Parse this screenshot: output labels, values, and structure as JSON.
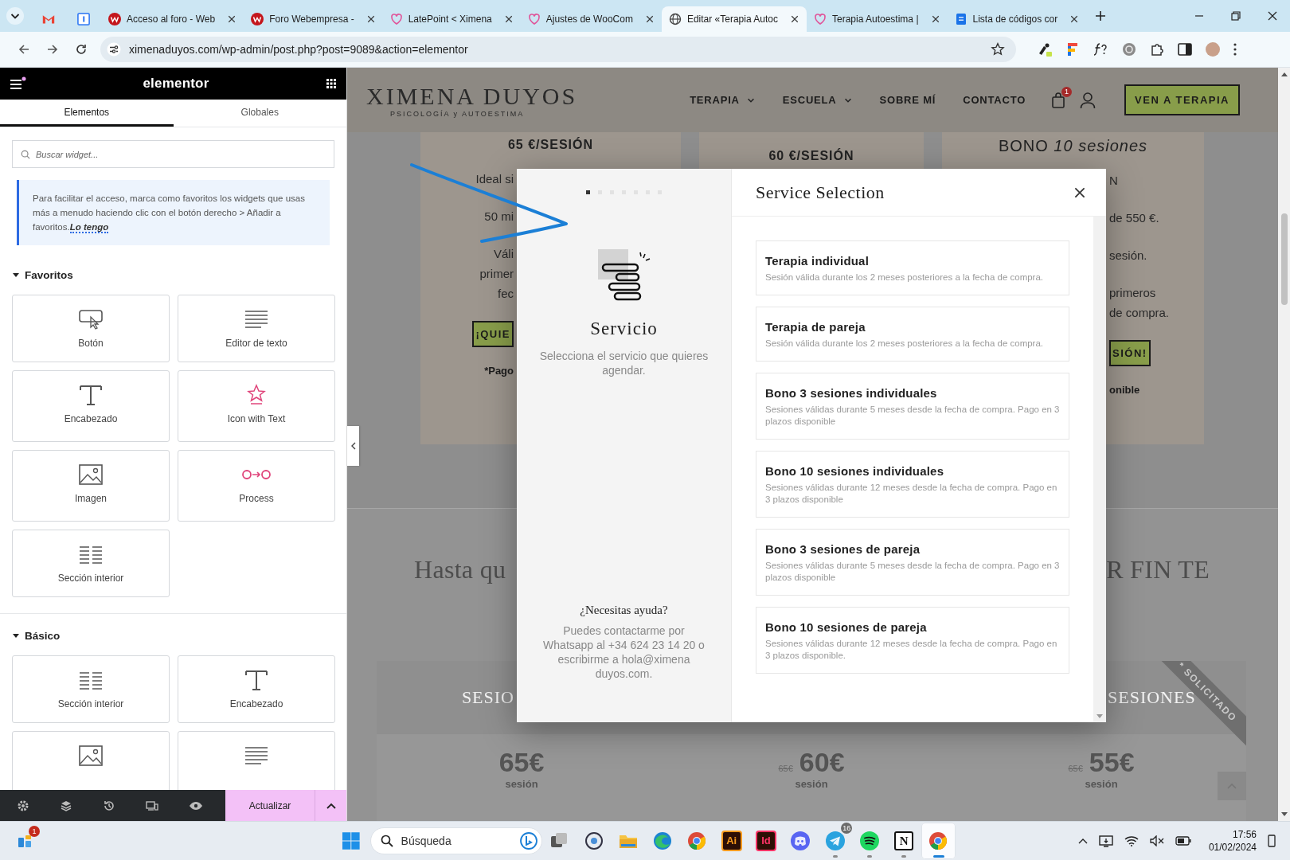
{
  "browser": {
    "tabs": [
      {
        "kind": "gmail",
        "selected": false
      },
      {
        "kind": "calendar",
        "selected": false
      },
      {
        "kind": "webempresa",
        "title": "Acceso al foro - Web",
        "selected": false
      },
      {
        "kind": "webempresa",
        "title": "Foro Webempresa -",
        "selected": false
      },
      {
        "kind": "heart",
        "title": "LatePoint < Ximena",
        "selected": false
      },
      {
        "kind": "heart",
        "title": "Ajustes de WooCom",
        "selected": false
      },
      {
        "kind": "globe",
        "title": "Editar «Terapia Autoc",
        "selected": true
      },
      {
        "kind": "heart",
        "title": "Terapia Autoestima |",
        "selected": false
      },
      {
        "kind": "docs",
        "title": "Lista de códigos cor",
        "selected": false
      }
    ],
    "url": "ximenaduyos.com/wp-admin/post.php?post=9089&action=elementor"
  },
  "editor": {
    "logo": "elementor",
    "tabs": [
      {
        "label": "Elementos",
        "selected": true
      },
      {
        "label": "Globales",
        "selected": false
      }
    ],
    "search": {
      "placeholder": "Buscar widget..."
    },
    "notice": {
      "text": "Para facilitar el acceso, marca como favoritos los widgets que usas más a menudo haciendo clic con el botón derecho > Añadir a favoritos.",
      "link": "Lo tengo"
    },
    "categories": [
      {
        "title": "Favoritos",
        "expanded": true,
        "widgets": [
          {
            "kind": "button",
            "label": "Botón"
          },
          {
            "kind": "text-editor",
            "label": "Editor de texto"
          },
          {
            "kind": "heading",
            "label": "Encabezado"
          },
          {
            "kind": "icon-text",
            "label": "Icon with Text"
          },
          {
            "kind": "image",
            "label": "Imagen"
          },
          {
            "kind": "process",
            "label": "Process"
          },
          {
            "kind": "inner-section",
            "label": "Sección interior"
          }
        ]
      },
      {
        "title": "Básico",
        "expanded": true,
        "widgets": [
          {
            "kind": "inner-section",
            "label": "Sección interior"
          },
          {
            "kind": "heading",
            "label": "Encabezado"
          },
          {
            "kind": "image"
          },
          {
            "kind": "text-editor"
          }
        ]
      }
    ],
    "update_button": "Actualizar"
  },
  "site": {
    "logo": {
      "name": "XIMENA DUYOS",
      "tagline": "PSICOLOGÍA y AUTOESTIMA"
    },
    "nav": [
      {
        "label": "TERAPIA",
        "dropdown": true
      },
      {
        "label": "ESCUELA",
        "dropdown": true
      },
      {
        "label": "SOBRE MÍ",
        "dropdown": false
      },
      {
        "label": "CONTACTO",
        "dropdown": false
      }
    ],
    "cart_badge": "1",
    "cta": "VEN A TERAPIA",
    "pricing_cards": [
      {
        "title": "65 €/SESIÓN",
        "features": [
          [
            "Ideal si"
          ],
          [
            "50 mi"
          ],
          [
            "Váli",
            "primer",
            "fec"
          ]
        ],
        "button": "¡QUIE",
        "note": "*Pago"
      },
      {
        "title": "60 €/SESIÓN"
      },
      {
        "title": "BONO *10 sesiones*",
        "features": [
          [
            "N"
          ],
          [
            "de 550 €."
          ],
          [
            "sesión."
          ],
          [
            "primeros",
            "de compra."
          ]
        ],
        "button": "SIÓN!",
        "note": "onible"
      }
    ],
    "heading_left": "Hasta qu",
    "heading_right": "R FIN TE",
    "offer_cards": [
      {
        "header": "SESIO",
        "price": "65€",
        "unit": "sesión"
      },
      {
        "old_price": "65€",
        "price": "60€",
        "unit": "sesión"
      },
      {
        "header": "SESIONES",
        "ribbon": "* SOLICITADO",
        "old_price": "65€",
        "price": "55€",
        "unit": "sesión"
      }
    ]
  },
  "modal": {
    "steps": [
      {
        "selected": true
      },
      {
        "selected": false
      },
      {
        "selected": false
      },
      {
        "selected": false
      },
      {
        "selected": false
      },
      {
        "selected": false
      },
      {
        "selected": false
      }
    ],
    "step_title": "Servicio",
    "step_description": "Selecciona el servicio que quieres agendar.",
    "help_title": "¿Necesitas ayuda?",
    "help_text": "Puedes contactarme por Whatsapp al +34 624 23 14 20 o escribirme a hola@ximena duyos.com.",
    "title": "Service Selection",
    "services": [
      {
        "name": "Terapia individual",
        "description": "Sesión válida durante los 2 meses posteriores a la fecha de compra."
      },
      {
        "name": "Terapia de pareja",
        "description": "Sesión válida durante los 2 meses posteriores a la fecha de compra."
      },
      {
        "name": "Bono 3 sesiones individuales",
        "description": "Sesiones válidas durante 5 meses desde la fecha de compra. Pago en 3 plazos disponible"
      },
      {
        "name": "Bono 10 sesiones individuales",
        "description": "Sesiones válidas durante 12 meses desde la fecha de compra. Pago en 3 plazos disponible"
      },
      {
        "name": "Bono 3 sesiones de pareja",
        "description": "Sesiones válidas durante 5 meses desde la fecha de compra. Pago en 3 plazos disponible"
      },
      {
        "name": "Bono 10 sesiones de pareja",
        "description": "Sesiones válidas durante 12 meses desde la fecha de compra. Pago en 3 plazos disponible."
      }
    ]
  },
  "taskbar": {
    "widgets_badge": "1",
    "search_placeholder": "Búsqueda",
    "apps": [
      {
        "kind": "task-view",
        "running": false,
        "active": false
      },
      {
        "kind": "ring",
        "running": false,
        "active": false
      },
      {
        "kind": "folder",
        "running": false,
        "active": false
      },
      {
        "kind": "edge",
        "running": false,
        "active": false
      },
      {
        "kind": "chrome",
        "running": false,
        "active": false
      },
      {
        "kind": "letters",
        "label": "Ai",
        "color": "#f79a1e",
        "running": false,
        "active": false
      },
      {
        "kind": "letters",
        "label": "Id",
        "color": "#ff3366",
        "running": false,
        "active": false
      },
      {
        "kind": "discord",
        "running": false,
        "active": false
      },
      {
        "kind": "telegram",
        "badge": "16",
        "running": true,
        "active": false
      },
      {
        "kind": "spotify",
        "running": true,
        "active": false
      },
      {
        "kind": "notion",
        "label": "N",
        "running": true,
        "active": false
      },
      {
        "kind": "chrome",
        "running": true,
        "active": true
      }
    ],
    "time": "17:56",
    "date": "01/02/2024"
  }
}
